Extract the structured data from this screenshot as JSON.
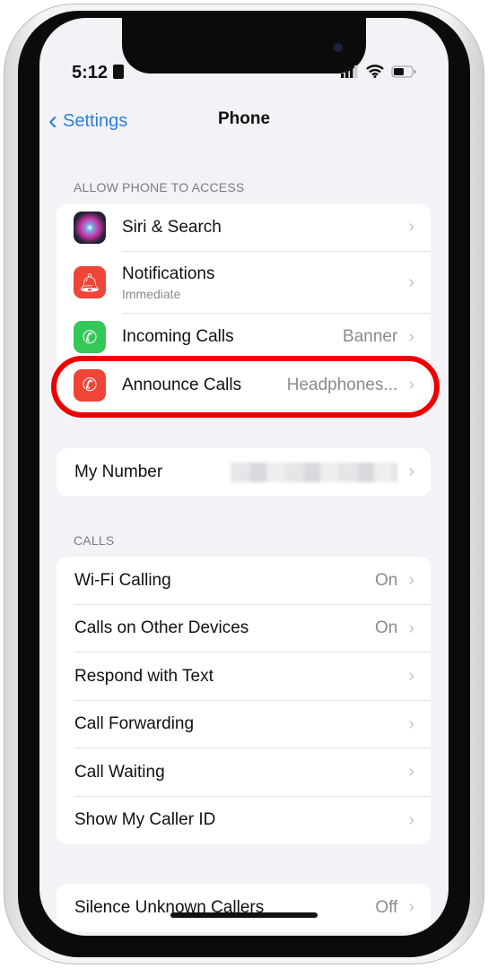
{
  "status_bar": {
    "time": "5:12"
  },
  "nav": {
    "back_label": "Settings",
    "title": "Phone"
  },
  "section_access": {
    "header": "ALLOW PHONE TO ACCESS",
    "items": [
      {
        "label": "Siri & Search",
        "value": "",
        "icon": "siri-icon"
      },
      {
        "label": "Notifications",
        "subtitle": "Immediate",
        "icon": "bell-icon"
      },
      {
        "label": "Incoming Calls",
        "value": "Banner",
        "icon": "incoming-call-icon"
      },
      {
        "label": "Announce Calls",
        "value": "Headphones...",
        "icon": "announce-call-icon"
      }
    ]
  },
  "my_number": {
    "label": "My Number"
  },
  "section_calls": {
    "header": "CALLS",
    "items": [
      {
        "label": "Wi-Fi Calling",
        "value": "On"
      },
      {
        "label": "Calls on Other Devices",
        "value": "On"
      },
      {
        "label": "Respond with Text",
        "value": ""
      },
      {
        "label": "Call Forwarding",
        "value": ""
      },
      {
        "label": "Call Waiting",
        "value": ""
      },
      {
        "label": "Show My Caller ID",
        "value": ""
      }
    ]
  },
  "silence": {
    "label": "Silence Unknown Callers",
    "value": "Off"
  },
  "colors": {
    "accent": "#2f7ee0",
    "highlight": "#e00000",
    "red_icon": "#ef4438",
    "green_icon": "#34c759"
  }
}
